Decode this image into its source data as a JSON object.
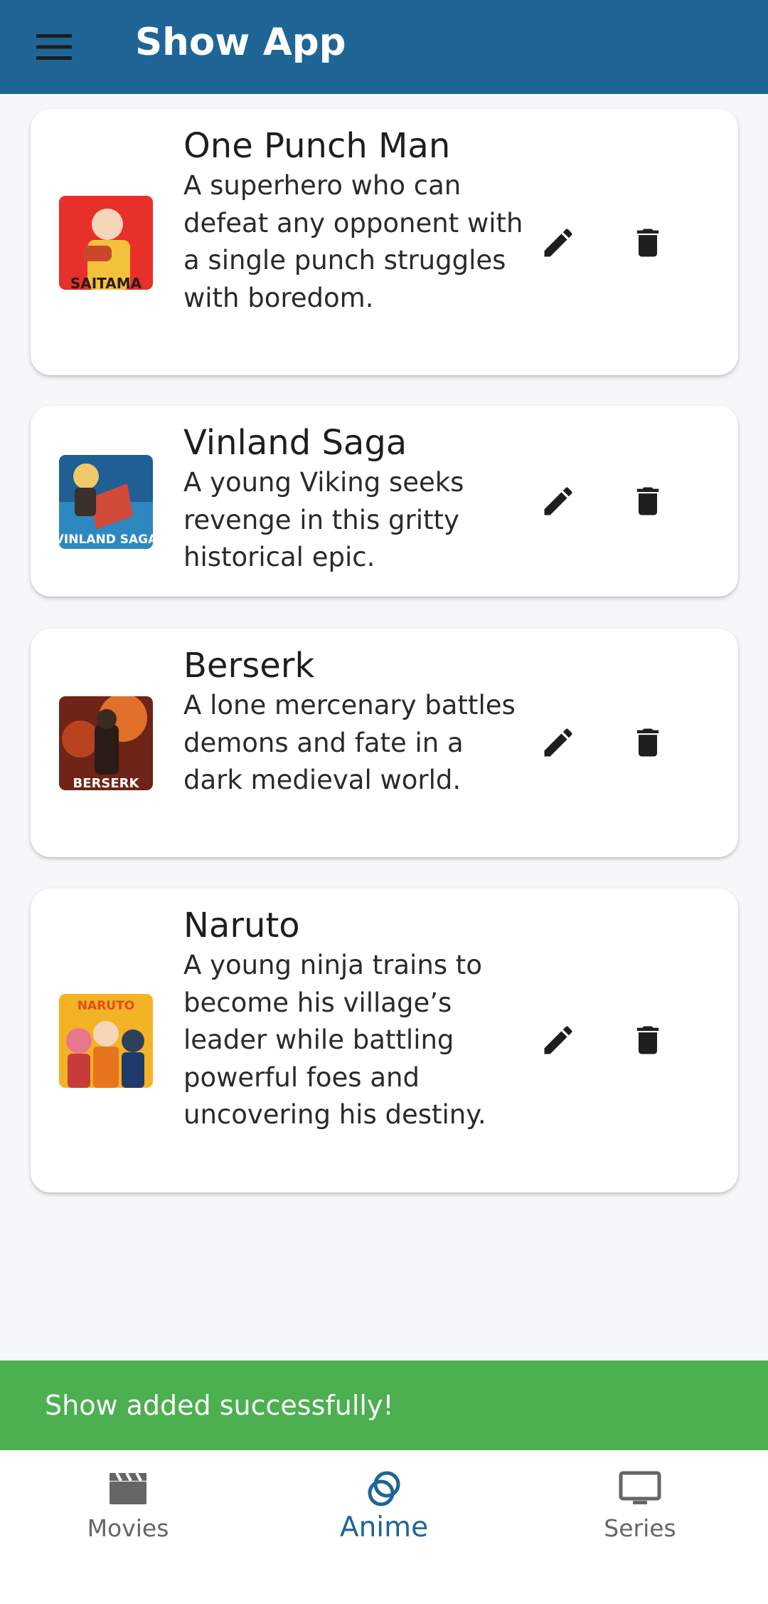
{
  "app": {
    "title": "Show App",
    "accent_color": "#1f6596",
    "menu_icon": "menu-icon"
  },
  "shows": [
    {
      "title": "One Punch Man",
      "description": "A superhero who can defeat any opponent with a single punch struggles with boredom.",
      "thumbnail_text": "SAITAMA",
      "edit_icon": "pencil-icon",
      "delete_icon": "trash-icon"
    },
    {
      "title": "Vinland Saga",
      "description": "A young Viking seeks revenge in this gritty historical epic.",
      "thumbnail_text": "VINLAND SAGA",
      "edit_icon": "pencil-icon",
      "delete_icon": "trash-icon"
    },
    {
      "title": "Berserk",
      "description": "A lone mercenary battles demons and fate in a dark medieval world.",
      "thumbnail_text": "BERSERK",
      "edit_icon": "pencil-icon",
      "delete_icon": "trash-icon"
    },
    {
      "title": "Naruto",
      "description": "A young ninja trains to become his village’s leader while battling powerful foes and uncovering his destiny.",
      "thumbnail_text": "NARUTO",
      "edit_icon": "pencil-icon",
      "delete_icon": "trash-icon"
    }
  ],
  "snackbar": {
    "message": "Show added successfully!",
    "color": "#4caf50"
  },
  "bottom_nav": {
    "items": [
      {
        "label": "Movies",
        "icon": "clapperboard-icon",
        "active": false
      },
      {
        "label": "Anime",
        "icon": "rings-icon",
        "active": true
      },
      {
        "label": "Series",
        "icon": "tv-icon",
        "active": false
      }
    ]
  }
}
